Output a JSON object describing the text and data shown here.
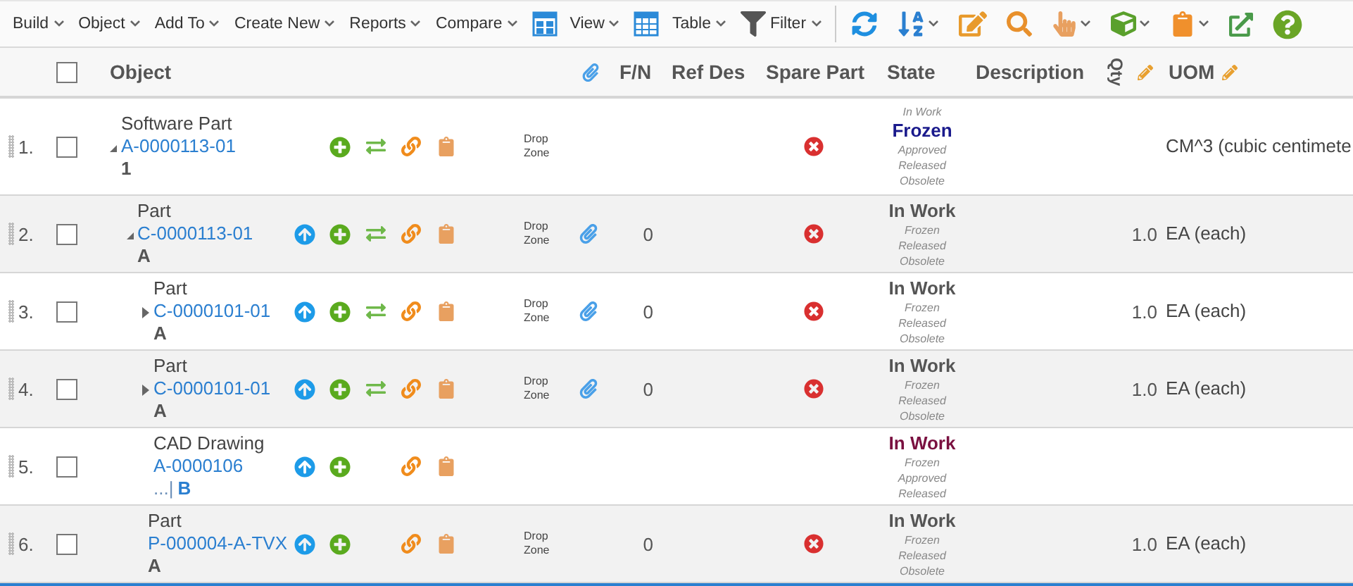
{
  "toolbar": [
    {
      "kind": "menu",
      "label": "Build"
    },
    {
      "kind": "menu",
      "label": "Object"
    },
    {
      "kind": "menu",
      "label": "Add To"
    },
    {
      "kind": "menu",
      "label": "Create New"
    },
    {
      "kind": "menu",
      "label": "Reports"
    },
    {
      "kind": "menu",
      "label": "Compare"
    },
    {
      "kind": "view",
      "label": "View"
    },
    {
      "kind": "table",
      "label": "Table"
    },
    {
      "kind": "filter",
      "label": "Filter"
    },
    {
      "kind": "refresh"
    },
    {
      "kind": "sort"
    },
    {
      "kind": "edit"
    },
    {
      "kind": "search"
    },
    {
      "kind": "table-pick"
    },
    {
      "kind": "cube-pick"
    },
    {
      "kind": "clipboard"
    },
    {
      "kind": "export"
    },
    {
      "kind": "help"
    }
  ],
  "header": {
    "select_all_checked": false,
    "columns": [
      {
        "kind": "text",
        "label": "Object"
      },
      {
        "kind": "attachment"
      },
      {
        "kind": "text",
        "label": "F/N"
      },
      {
        "kind": "text",
        "label": "Ref Des"
      },
      {
        "kind": "text",
        "label": "Spare Part"
      },
      {
        "kind": "text",
        "label": "State"
      },
      {
        "kind": "text",
        "label": "Description"
      },
      {
        "kind": "vertical",
        "label": "Qty",
        "editable": true
      },
      {
        "kind": "text",
        "label": "UOM",
        "editable": true
      }
    ]
  },
  "rows": [
    {
      "index": "1.",
      "checked": false,
      "type": "Software Part",
      "number": "A-0000113-01",
      "revision": "1",
      "revision_link": false,
      "expanded": true,
      "navigate": false,
      "add": true,
      "refresh": true,
      "link": true,
      "clipboard": true,
      "drop_zone": "Drop Zone",
      "spare_part": false,
      "states": [
        {
          "label": "In Work",
          "selected": false
        },
        {
          "label": "Frozen",
          "selected": true,
          "color": "#1a1a8c"
        },
        {
          "label": "Approved",
          "selected": false
        },
        {
          "label": "Released",
          "selected": false
        },
        {
          "label": "Obsolete",
          "selected": false
        }
      ],
      "uom": "CM^3 (cubic centimete",
      "children": [
        {
          "index": "2.",
          "checked": false,
          "type": "Part",
          "number": "C-0000113-01",
          "revision": "A",
          "revision_link": false,
          "expanded": true,
          "navigate": true,
          "add": true,
          "refresh": true,
          "link": true,
          "clipboard": true,
          "drop_zone": "Drop Zone",
          "attachment": true,
          "fn": "0",
          "spare_part": false,
          "states": [
            {
              "label": "In Work",
              "selected": true,
              "color": "#555555"
            },
            {
              "label": "Frozen",
              "selected": false
            },
            {
              "label": "Released",
              "selected": false
            },
            {
              "label": "Obsolete",
              "selected": false
            }
          ],
          "qty": "1.0",
          "uom": "EA (each)",
          "children": [
            {
              "index": "3.",
              "checked": false,
              "type": "Part",
              "number": "C-0000101-01",
              "revision": "A",
              "revision_link": false,
              "expanded": false,
              "navigate": true,
              "add": true,
              "refresh": true,
              "link": true,
              "clipboard": true,
              "drop_zone": "Drop Zone",
              "attachment": true,
              "fn": "0",
              "spare_part": false,
              "states": [
                {
                  "label": "In Work",
                  "selected": true,
                  "color": "#555555"
                },
                {
                  "label": "Frozen",
                  "selected": false
                },
                {
                  "label": "Released",
                  "selected": false
                },
                {
                  "label": "Obsolete",
                  "selected": false
                }
              ],
              "qty": "1.0",
              "uom": "EA (each)"
            },
            {
              "index": "4.",
              "checked": false,
              "type": "Part",
              "number": "C-0000101-01",
              "revision": "A",
              "revision_link": false,
              "expanded": false,
              "navigate": true,
              "add": true,
              "refresh": true,
              "link": true,
              "clipboard": true,
              "drop_zone": "Drop Zone",
              "attachment": true,
              "fn": "0",
              "spare_part": false,
              "states": [
                {
                  "label": "In Work",
                  "selected": true,
                  "color": "#555555"
                },
                {
                  "label": "Frozen",
                  "selected": false
                },
                {
                  "label": "Released",
                  "selected": false
                },
                {
                  "label": "Obsolete",
                  "selected": false
                }
              ],
              "qty": "1.0",
              "uom": "EA (each)"
            },
            {
              "index": "5.",
              "checked": false,
              "type": "CAD Drawing",
              "number": "A-0000106",
              "revision_prefix": "...|",
              "revision": "B",
              "revision_link": true,
              "navigate": true,
              "add": true,
              "refresh": false,
              "link": true,
              "clipboard": true,
              "states": [
                {
                  "label": "In Work",
                  "selected": true,
                  "color": "#7a1040"
                },
                {
                  "label": "Frozen",
                  "selected": false
                },
                {
                  "label": "Approved",
                  "selected": false
                },
                {
                  "label": "Released",
                  "selected": false
                }
              ]
            },
            {
              "index": "6.",
              "checked": false,
              "type": "Part",
              "number": "P-000004-A-TVX",
              "revision": "A",
              "revision_link": false,
              "navigate": true,
              "add": true,
              "refresh": false,
              "link": true,
              "clipboard": true,
              "drop_zone": "Drop Zone",
              "fn": "0",
              "spare_part": false,
              "states": [
                {
                  "label": "In Work",
                  "selected": true,
                  "color": "#555555"
                },
                {
                  "label": "Frozen",
                  "selected": false
                },
                {
                  "label": "Released",
                  "selected": false
                },
                {
                  "label": "Obsolete",
                  "selected": false
                }
              ],
              "qty": "1.0",
              "uom": "EA (each)"
            }
          ]
        }
      ]
    }
  ]
}
